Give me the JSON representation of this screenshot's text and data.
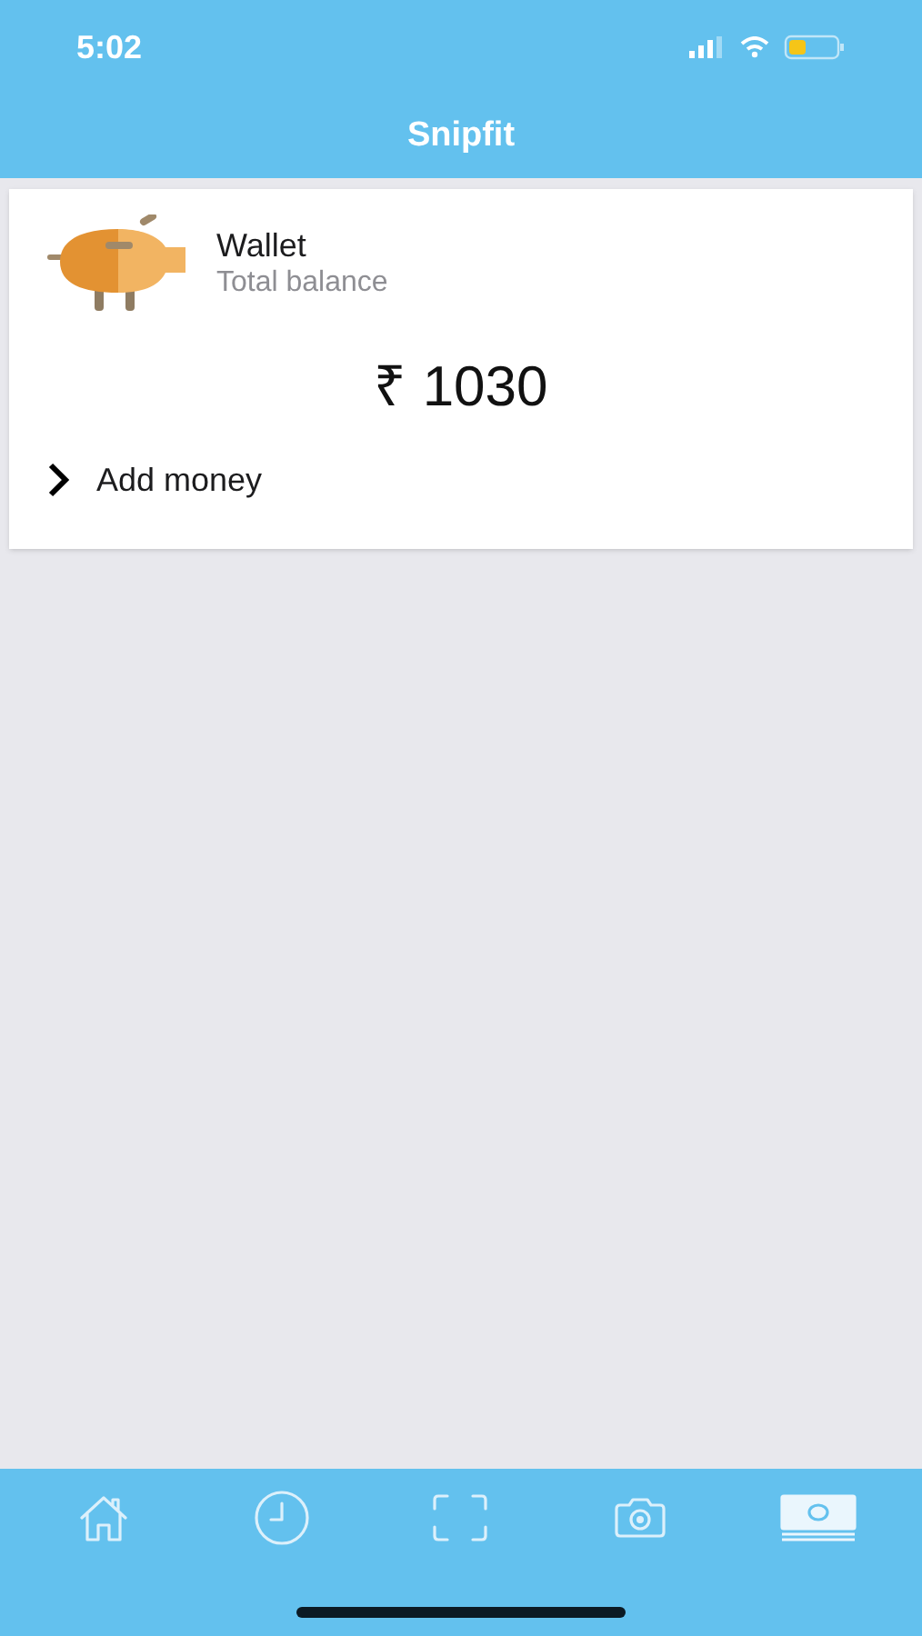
{
  "status_bar": {
    "time": "5:02"
  },
  "nav_bar": {
    "title": "Snipfit"
  },
  "wallet": {
    "title": "Wallet",
    "subtitle": "Total balance",
    "balance": "₹ 1030",
    "action": "Add money"
  },
  "tab_bar": [
    {
      "kind": "home",
      "selected": false
    },
    {
      "kind": "history",
      "selected": false
    },
    {
      "kind": "scan",
      "selected": false
    },
    {
      "kind": "camera",
      "selected": false
    },
    {
      "kind": "money",
      "selected": true
    }
  ]
}
